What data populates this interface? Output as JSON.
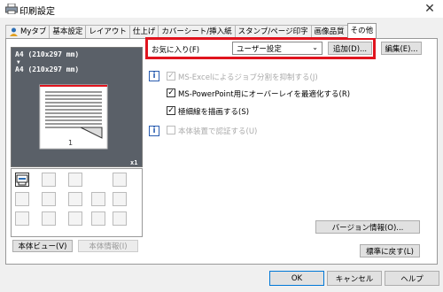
{
  "window": {
    "title": "印刷設定"
  },
  "tabs": [
    {
      "label": "Myタブ",
      "icon": "person-icon"
    },
    {
      "label": "基本設定"
    },
    {
      "label": "レイアウト"
    },
    {
      "label": "仕上げ"
    },
    {
      "label": "カバーシート/挿入紙"
    },
    {
      "label": "スタンプ/ページ印字"
    },
    {
      "label": "画像品質"
    },
    {
      "label": "その他",
      "active": true
    }
  ],
  "preview": {
    "line1": "A4 (210x297 mm)",
    "arrow": "▼",
    "line2": "A4 (210x297 mm)",
    "copies": "x1"
  },
  "preview_buttons": {
    "printer_view": "本体ビュー(V)",
    "printer_info": "本体情報(I)"
  },
  "favorites": {
    "label": "お気に入り(F)",
    "value": "ユーザー設定",
    "add": "追加(D)...",
    "edit": "編集(E)..."
  },
  "options": [
    {
      "label": "MS-Excelによるジョブ分割を抑制する(J)",
      "checked": true,
      "enabled": false
    },
    {
      "label": "MS-PowerPoint用にオーバーレイを最適化する(R)",
      "checked": true,
      "enabled": true
    },
    {
      "label": "極細線を描画する(S)",
      "checked": true,
      "enabled": true
    },
    {
      "label": "本体装置で認証する(U)",
      "checked": false,
      "enabled": false
    }
  ],
  "version_button": "バージョン情報(O)...",
  "reset_button": "標準に戻す(L)",
  "footer": {
    "ok": "OK",
    "cancel": "キャンセル",
    "help": "ヘルプ"
  },
  "colors": {
    "highlight": "#e0141e",
    "accent": "#0078d7"
  },
  "icons": {
    "close": "close-icon",
    "info": "info-icon"
  }
}
